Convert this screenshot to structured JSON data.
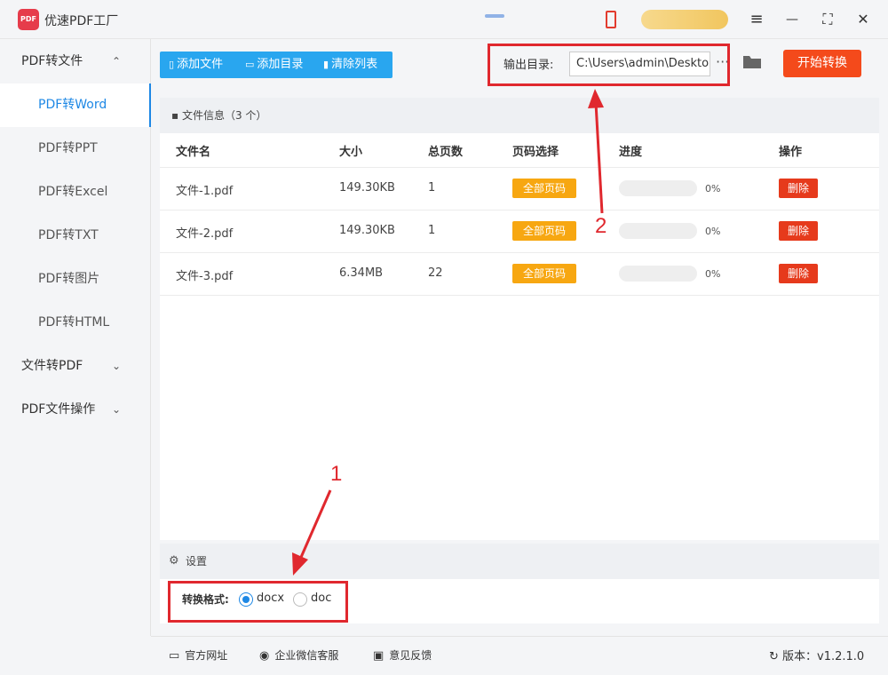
{
  "app": {
    "title": "优速PDF工厂",
    "logo_text": "PDF"
  },
  "window_controls": {
    "menu": "≡",
    "minimize": "—",
    "maximize": "⛶",
    "close": "✕"
  },
  "sidebar": {
    "groups": [
      {
        "label": "PDF转文件",
        "chevron": "⌃"
      },
      {
        "label": "文件转PDF",
        "chevron": "⌄"
      },
      {
        "label": "PDF文件操作",
        "chevron": "⌄"
      }
    ],
    "items": [
      {
        "label": "PDF转Word"
      },
      {
        "label": "PDF转PPT"
      },
      {
        "label": "PDF转Excel"
      },
      {
        "label": "PDF转TXT"
      },
      {
        "label": "PDF转图片"
      },
      {
        "label": "PDF转HTML"
      }
    ]
  },
  "toolbar": {
    "add_file": "添加文件",
    "add_dir": "添加目录",
    "clear_list": "清除列表",
    "output_label": "输出目录:",
    "output_path": "C:\\Users\\admin\\Deskto",
    "more": "···",
    "start": "开始转换"
  },
  "file_info": {
    "title": "文件信息（3 个）"
  },
  "table": {
    "headers": {
      "name": "文件名",
      "size": "大小",
      "pages": "总页数",
      "page_select": "页码选择",
      "progress": "进度",
      "action": "操作"
    },
    "rows": [
      {
        "name": "文件-1.pdf",
        "size": "149.30KB",
        "pages": "1",
        "page_select": "全部页码",
        "progress_text": "0%",
        "progress": 0,
        "action": "删除"
      },
      {
        "name": "文件-2.pdf",
        "size": "149.30KB",
        "pages": "1",
        "page_select": "全部页码",
        "progress_text": "0%",
        "progress": 0,
        "action": "删除"
      },
      {
        "name": "文件-3.pdf",
        "size": "6.34MB",
        "pages": "22",
        "page_select": "全部页码",
        "progress_text": "0%",
        "progress": 0,
        "action": "删除"
      }
    ]
  },
  "settings": {
    "title": "设置",
    "format_label": "转换格式:",
    "options": [
      {
        "label": "docx",
        "checked": true
      },
      {
        "label": "doc",
        "checked": false
      }
    ]
  },
  "footer": {
    "website": "官方网址",
    "wechat": "企业微信客服",
    "feedback": "意见反馈",
    "version": "版本：v1.2.1.0"
  },
  "annotations": {
    "one": "1",
    "two": "2"
  }
}
